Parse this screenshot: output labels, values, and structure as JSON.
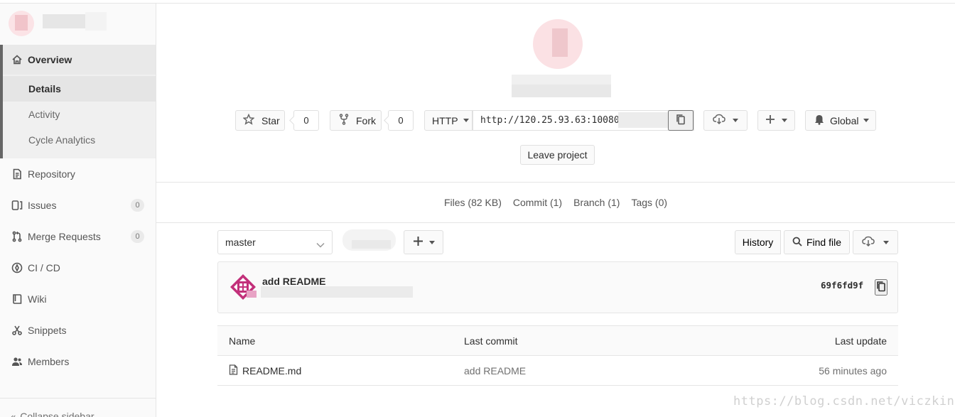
{
  "sidebar": {
    "overview": "Overview",
    "overview_sub": [
      "Details",
      "Activity",
      "Cycle Analytics"
    ],
    "items": [
      {
        "label": "Repository",
        "icon": "book-icon"
      },
      {
        "label": "Issues",
        "icon": "issues-icon",
        "badge": "0"
      },
      {
        "label": "Merge Requests",
        "icon": "merge-request-icon",
        "badge": "0"
      },
      {
        "label": "CI / CD",
        "icon": "rocket-icon"
      },
      {
        "label": "Wiki",
        "icon": "book-icon"
      },
      {
        "label": "Snippets",
        "icon": "scissors-icon"
      },
      {
        "label": "Members",
        "icon": "users-icon"
      }
    ],
    "collapse": "Collapse sidebar"
  },
  "header": {
    "star_label": "Star",
    "star_count": "0",
    "fork_label": "Fork",
    "fork_count": "0",
    "protocol": "HTTP",
    "clone_url": "http://120.25.93.63:10080",
    "notification": "Global",
    "leave_label": "Leave project"
  },
  "stats": {
    "files": "Files (82 KB)",
    "commits": "Commit (1)",
    "branches": "Branch (1)",
    "tags": "Tags (0)"
  },
  "tree": {
    "branch": "master",
    "history_label": "History",
    "find_label": "Find file"
  },
  "last_commit": {
    "message": "add README",
    "sha": "69f6fd9f"
  },
  "table": {
    "headers": {
      "name": "Name",
      "last_commit": "Last commit",
      "last_update": "Last update"
    },
    "rows": [
      {
        "name": "README.md",
        "commit": "add README",
        "updated": "56 minutes ago"
      }
    ]
  },
  "watermark": "https://blog.csdn.net/viczking"
}
